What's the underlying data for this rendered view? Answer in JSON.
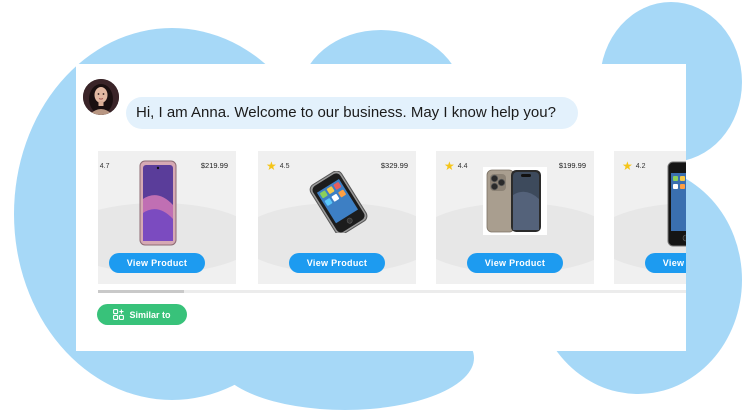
{
  "chat": {
    "agent_avatar": "avatar",
    "message": "Hi, I am Anna. Welcome to our business. May I know help you?"
  },
  "products": [
    {
      "rating": "4.7",
      "price": "$219.99",
      "button": "View Product",
      "image": "android-phone-purple"
    },
    {
      "rating": "4.5",
      "price": "$329.99",
      "button": "View Product",
      "image": "iphone-original"
    },
    {
      "rating": "4.4",
      "price": "$199.99",
      "button": "View Product",
      "image": "iphone-titanium"
    },
    {
      "rating": "4.2",
      "price": "",
      "button": "View Product",
      "image": "iphone-4"
    }
  ],
  "carousel": {
    "scroll_position": 0.0
  },
  "actions": {
    "similar_label": "Similar to"
  },
  "colors": {
    "blob": "#a6d8f7",
    "bubble": "#e3f1fc",
    "button": "#1d9bf0",
    "similar": "#38c27a",
    "star": "#f5c518"
  }
}
